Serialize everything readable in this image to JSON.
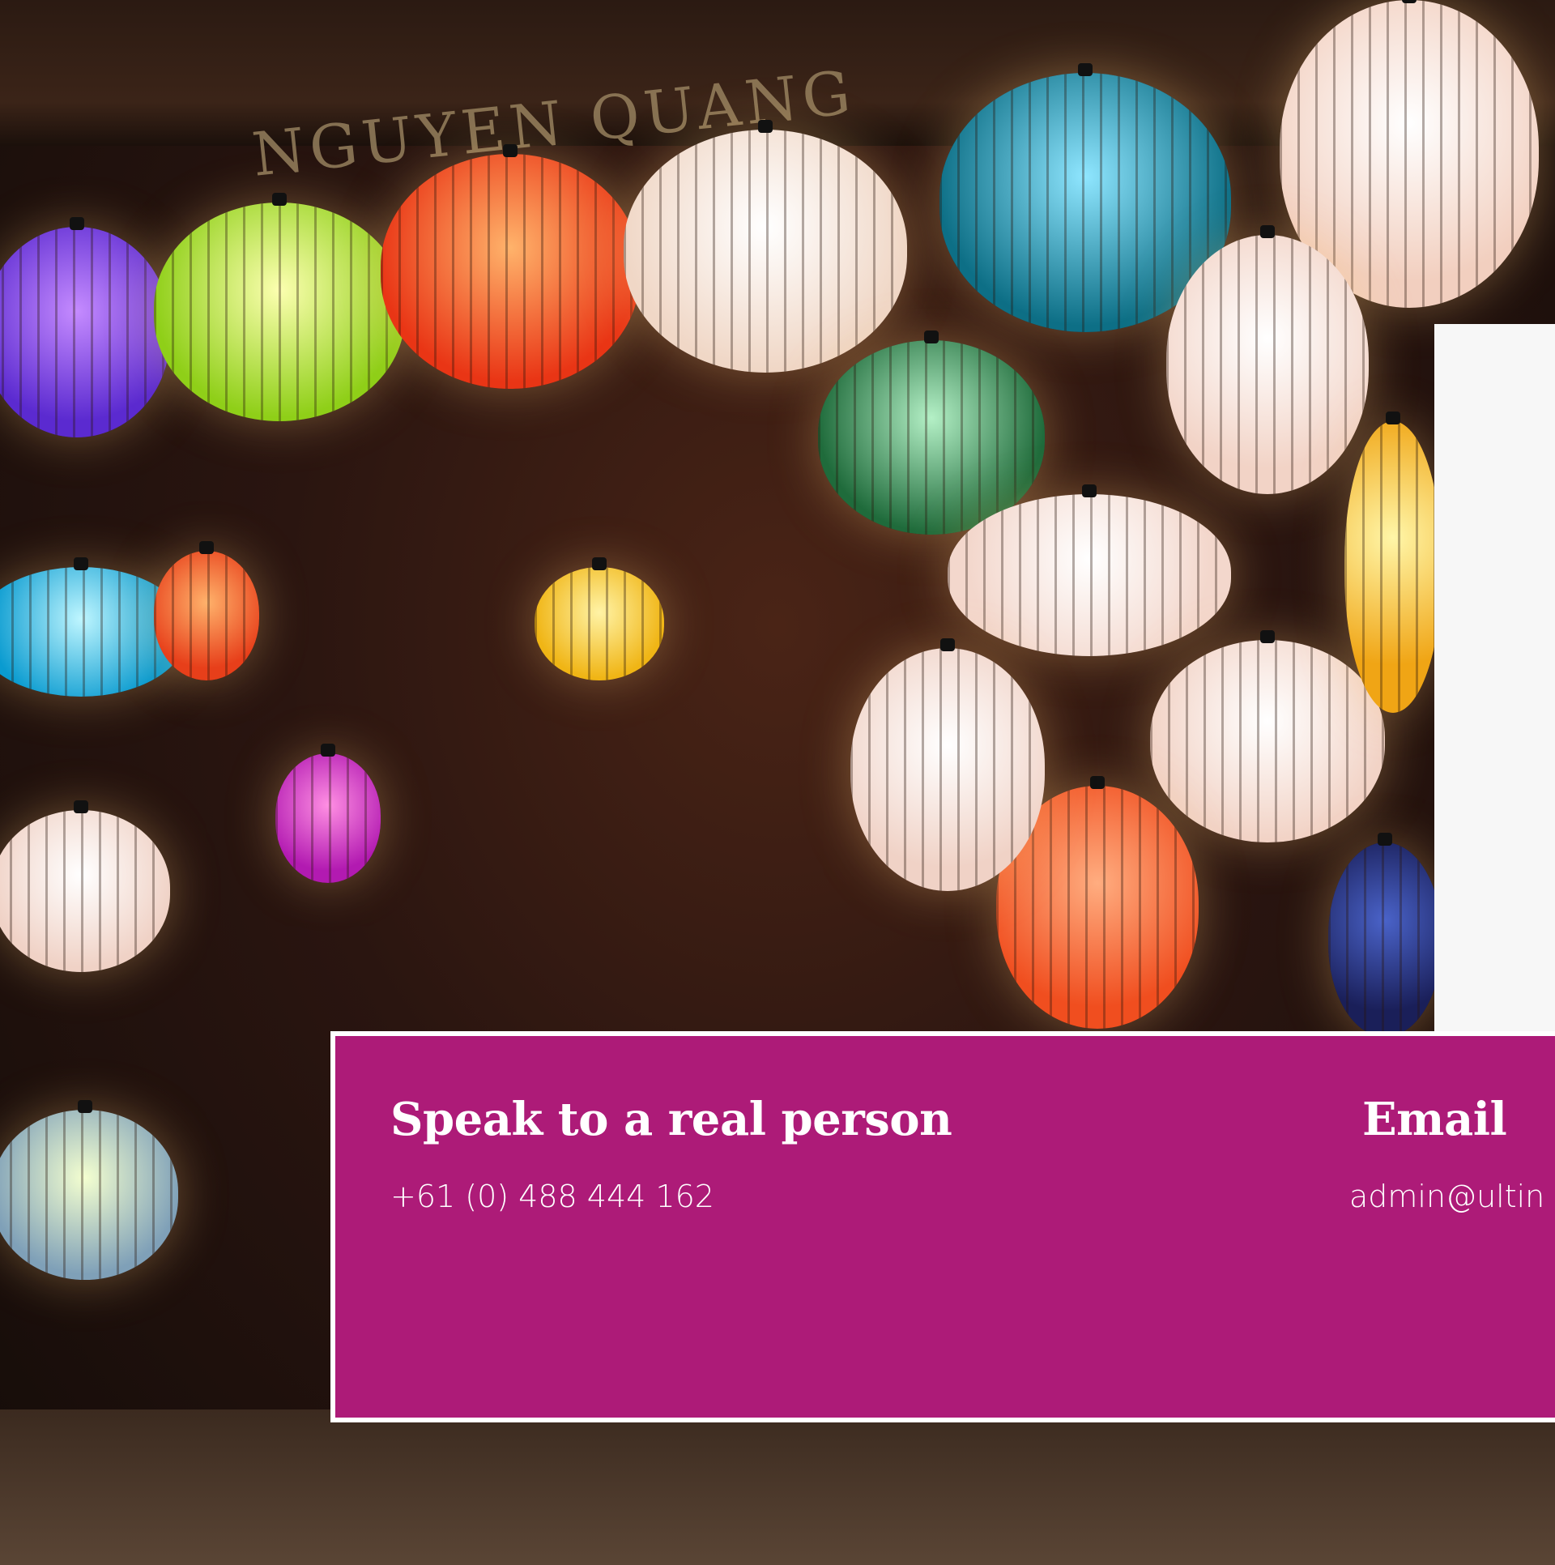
{
  "contact": {
    "phone_heading": "Speak to a real person",
    "phone_number": "+61 (0) 488 444 162",
    "email_heading": "Email",
    "email_address": "admin@ultin"
  },
  "colors": {
    "card_background": "#ad1b78",
    "card_border": "#ffffff",
    "side_panel": "#f7f7f7",
    "text": "#ffffff"
  },
  "hero": {
    "sign_text": "NGUYEN QUANG"
  }
}
